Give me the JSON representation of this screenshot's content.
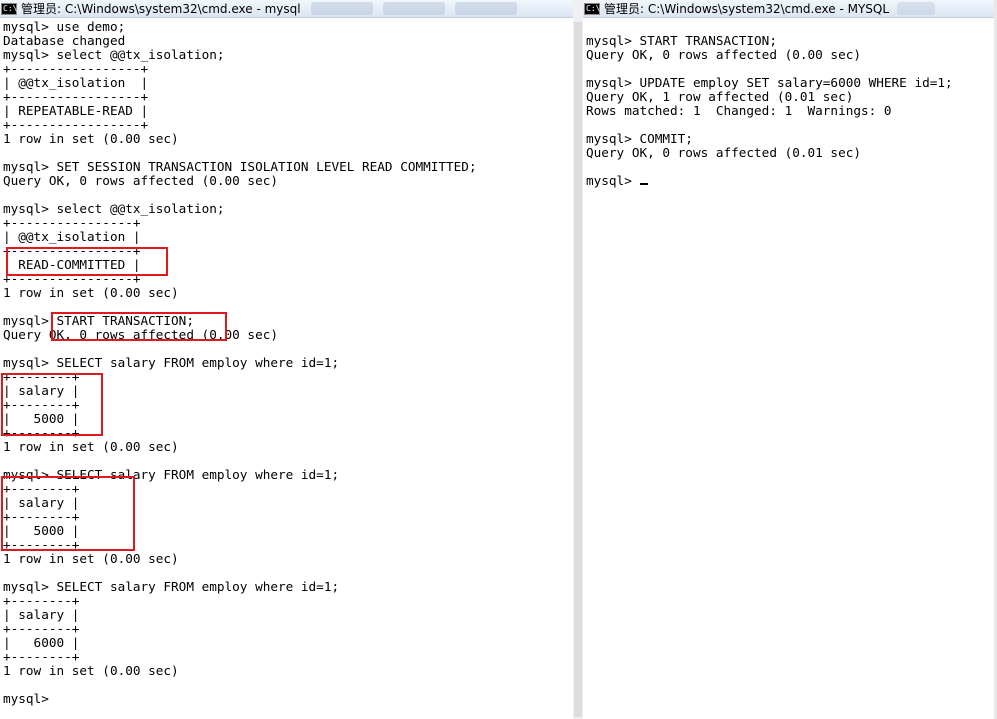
{
  "left_window": {
    "title": "管理员: C:\\Windows\\system32\\cmd.exe - mysql",
    "icon": "cmd-console-icon",
    "lines": [
      "mysql> use demo;",
      "Database changed",
      "mysql> select @@tx_isolation;",
      "+-----------------+",
      "| @@tx_isolation  |",
      "+-----------------+",
      "| REPEATABLE-READ |",
      "+-----------------+",
      "1 row in set (0.00 sec)",
      "",
      "mysql> SET SESSION TRANSACTION ISOLATION LEVEL READ COMMITTED;",
      "Query OK, 0 rows affected (0.00 sec)",
      "",
      "mysql> select @@tx_isolation;",
      "+----------------+",
      "| @@tx_isolation |",
      "+----------------+",
      "| READ-COMMITTED |",
      "+----------------+",
      "1 row in set (0.00 sec)",
      "",
      "mysql> START TRANSACTION;",
      "Query OK, 0 rows affected (0.00 sec)",
      "",
      "mysql> SELECT salary FROM employ where id=1;",
      "+--------+",
      "| salary |",
      "+--------+",
      "|   5000 |",
      "+--------+",
      "1 row in set (0.00 sec)",
      "",
      "mysql> SELECT salary FROM employ where id=1;",
      "+--------+",
      "| salary |",
      "+--------+",
      "|   5000 |",
      "+--------+",
      "1 row in set (0.00 sec)",
      "",
      "mysql> SELECT salary FROM employ where id=1;",
      "+--------+",
      "| salary |",
      "+--------+",
      "|   6000 |",
      "+--------+",
      "1 row in set (0.00 sec)",
      "",
      "mysql> "
    ]
  },
  "right_window": {
    "title": "管理员: C:\\Windows\\system32\\cmd.exe - MYSQL",
    "icon": "cmd-console-icon",
    "lines": [
      "",
      "mysql> START TRANSACTION;",
      "Query OK, 0 rows affected (0.00 sec)",
      "",
      "mysql> UPDATE employ SET salary=6000 WHERE id=1;",
      "Query OK, 1 row affected (0.01 sec)",
      "Rows matched: 1  Changed: 1  Warnings: 0",
      "",
      "mysql> COMMIT;",
      "Query OK, 0 rows affected (0.01 sec)",
      "",
      "mysql> "
    ]
  },
  "colors": {
    "highlight_border": "#e0191e",
    "console_background": "#ffffff",
    "console_text": "#000000"
  }
}
